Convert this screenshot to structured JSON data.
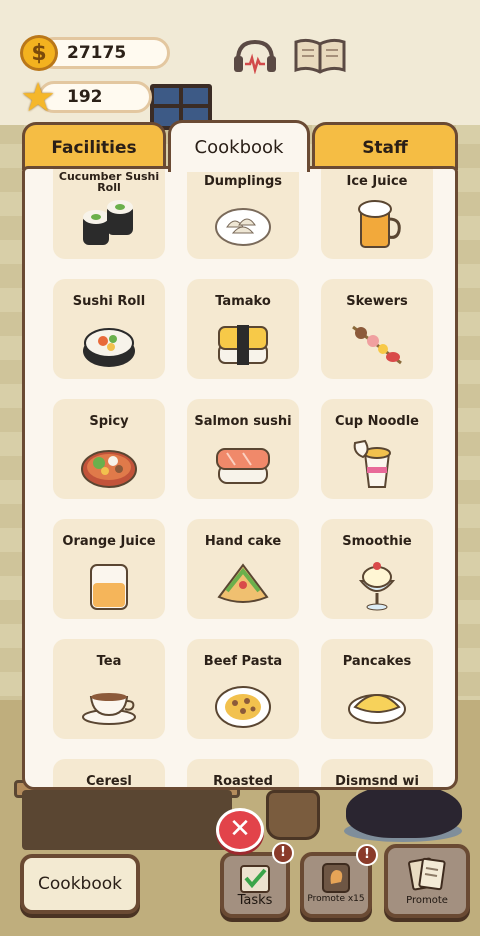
{
  "hud": {
    "coins": "27175",
    "stars": "192",
    "coin_symbol": "$",
    "star_symbol": "★"
  },
  "icons": {
    "headphones": "headphones-icon",
    "recipe_book": "open-book-icon"
  },
  "tabs": [
    {
      "label": "Facilities",
      "active": false
    },
    {
      "label": "Cookbook",
      "active": true
    },
    {
      "label": "Staff",
      "active": false
    }
  ],
  "cookbook": {
    "items": [
      {
        "label": "Cucumber Sushi Roll",
        "icon": "cucumber-roll-icon"
      },
      {
        "label": "Dumplings",
        "icon": "dumplings-icon"
      },
      {
        "label": "Ice Juice",
        "icon": "beer-mug-icon"
      },
      {
        "label": "Sushi Roll",
        "icon": "sushi-roll-icon"
      },
      {
        "label": "Tamako",
        "icon": "tamago-icon"
      },
      {
        "label": "Skewers",
        "icon": "skewer-icon"
      },
      {
        "label": "Spicy",
        "icon": "hotpot-icon"
      },
      {
        "label": "Salmon sushi",
        "icon": "salmon-sushi-icon"
      },
      {
        "label": "Cup Noodle",
        "icon": "cup-noodle-icon"
      },
      {
        "label": "Orange Juice",
        "icon": "juice-glass-icon"
      },
      {
        "label": "Hand cake",
        "icon": "wrap-icon"
      },
      {
        "label": "Smoothie",
        "icon": "sundae-icon"
      },
      {
        "label": "Tea",
        "icon": "teacup-icon"
      },
      {
        "label": "Beef Pasta",
        "icon": "pasta-icon"
      },
      {
        "label": "Pancakes",
        "icon": "omelette-icon"
      },
      {
        "label": "Ceresl",
        "icon": "cereal-icon"
      },
      {
        "label": "Roasted chicken",
        "icon": "roast-chicken-icon"
      },
      {
        "label": "Dismsnd wi",
        "icon": "dish-icon"
      }
    ]
  },
  "controls": {
    "close_symbol": "✕",
    "cookbook_label": "Cookbook",
    "tasks_label": "Tasks",
    "promote15_label": "Promote x15",
    "promote_label": "Promote",
    "badge_symbol": "!"
  },
  "colors": {
    "tab_inactive": "#f5bd44",
    "panel_bg": "#fbf6ee",
    "card_bg": "#f5e9d1",
    "border": "#6a4a33",
    "close_red": "#e2434a"
  }
}
